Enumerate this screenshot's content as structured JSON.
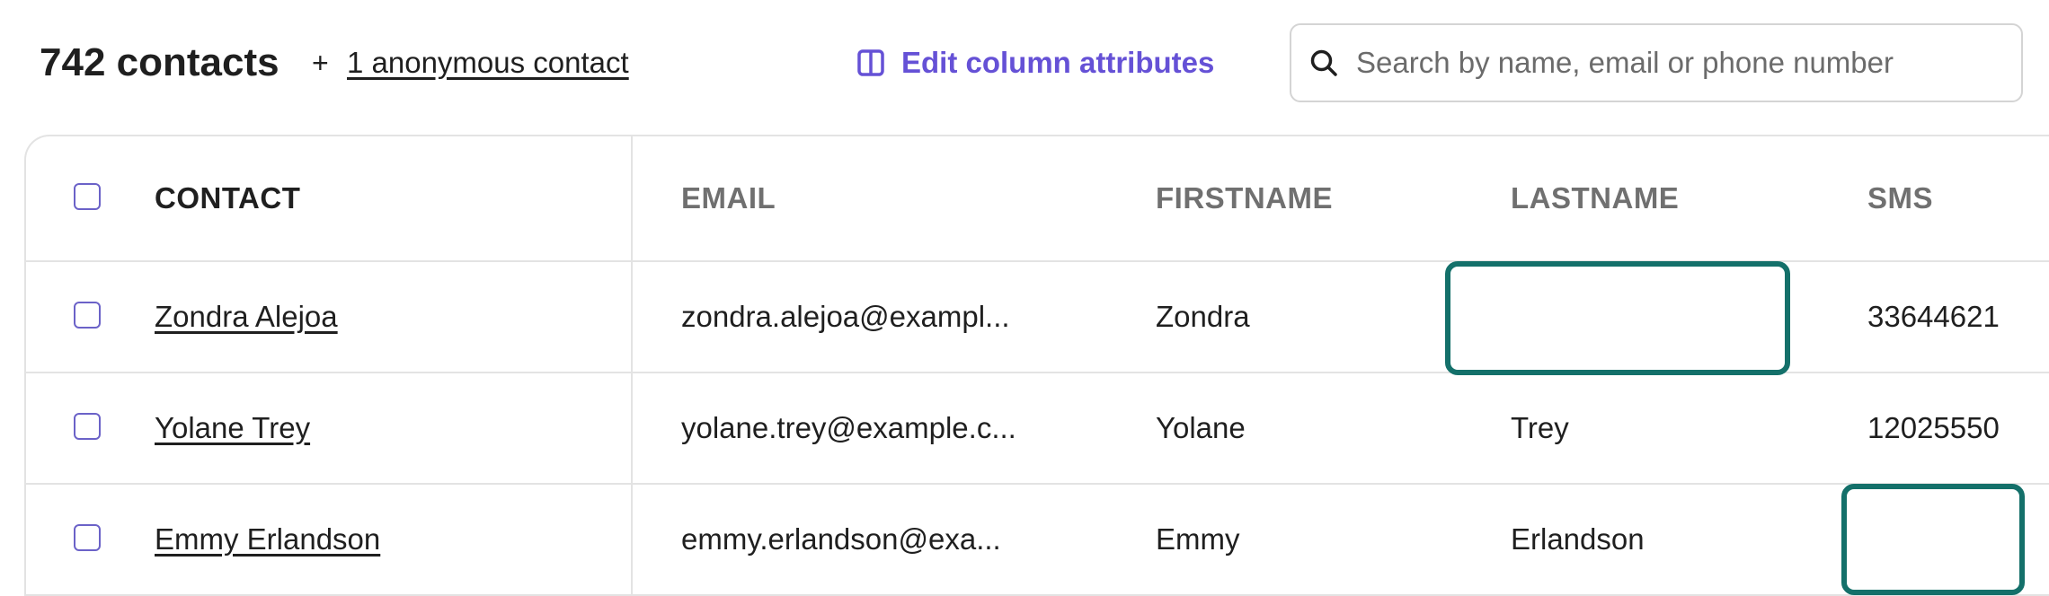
{
  "header": {
    "contact_count": "742 contacts",
    "plus": "+",
    "anonymous_link": "1 anonymous contact",
    "edit_columns_label": "Edit column attributes"
  },
  "search": {
    "placeholder": "Search by name, email or phone number",
    "value": ""
  },
  "table": {
    "columns": [
      "CONTACT",
      "EMAIL",
      "FIRSTNAME",
      "LASTNAME",
      "SMS"
    ],
    "rows": [
      {
        "contact": "Zondra Alejoa",
        "email": "zondra.alejoa@exampl...",
        "firstname": "Zondra",
        "lastname": "",
        "sms": "33644621"
      },
      {
        "contact": "Yolane Trey",
        "email": "yolane.trey@example.c...",
        "firstname": "Yolane",
        "lastname": "Trey",
        "sms": "12025550"
      },
      {
        "contact": "Emmy Erlandson",
        "email": "emmy.erlandson@exa...",
        "firstname": "Emmy",
        "lastname": "Erlandson",
        "sms": ""
      }
    ]
  },
  "icons": {
    "edit_columns": "columns-icon",
    "search": "search-icon",
    "checkbox": "checkbox-icon"
  },
  "colors": {
    "accent": "#6551d6",
    "highlight": "#14706a",
    "checkbox_border": "#6b62c8",
    "header_text": "#707070",
    "border": "#e3e3e3"
  }
}
